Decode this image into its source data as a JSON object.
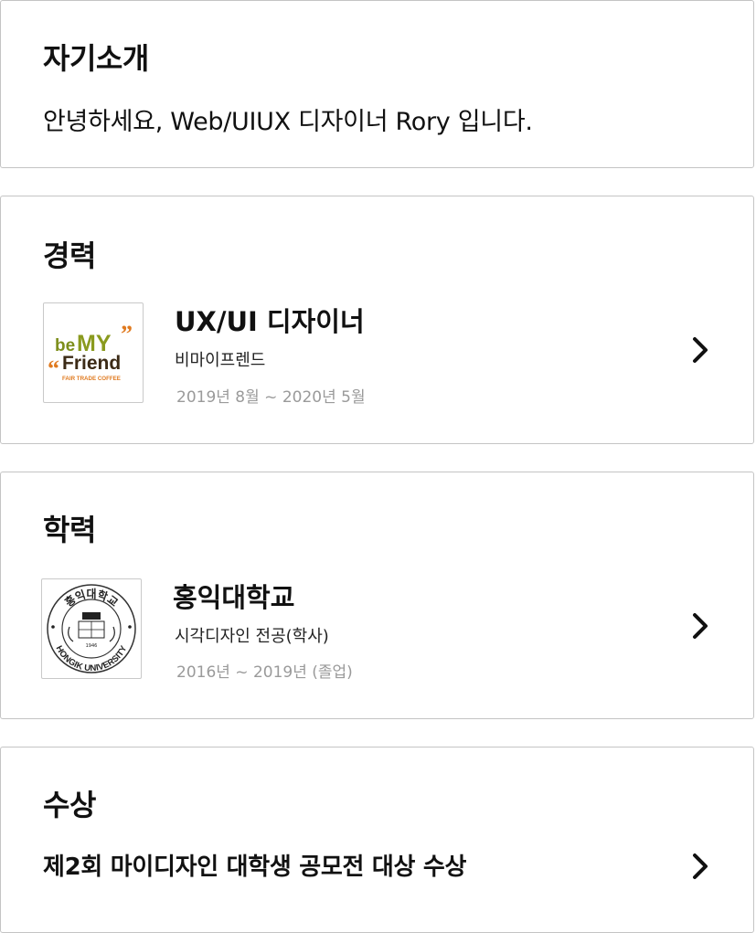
{
  "intro": {
    "title": "자기소개",
    "text": "안녕하세요, Web/UIUX 디자이너 Rory 입니다."
  },
  "career": {
    "title": "경력",
    "entries": [
      {
        "logo": {
          "line1_a": "be",
          "line1_b": "MY",
          "line2": "Friend",
          "tagline": "FAIR TRADE COFFEE",
          "accent": "#8a9a1e",
          "tag_color": "#e07a1f"
        },
        "role": "UX/UI 디자이너",
        "company": "비마이프렌드",
        "period": "2019년 8월 ~ 2020년 5월"
      }
    ]
  },
  "education": {
    "title": "학력",
    "entries": [
      {
        "logo": {
          "arc_top": "홍익대학교",
          "arc_bottom": "HONGIK UNIVERSITY",
          "year": "1946"
        },
        "school": "홍익대학교",
        "major": "시각디자인 전공(학사)",
        "period": "2016년 ~ 2019년 (졸업)"
      }
    ]
  },
  "awards": {
    "title": "수상",
    "items": [
      {
        "text": "제2회 마이디자인 대학생 공모전 대상 수상"
      }
    ]
  },
  "icons": {
    "chevron": "chevron-right-icon"
  },
  "colors": {
    "border": "#c4c4c4",
    "muted": "#9a9a9a"
  }
}
